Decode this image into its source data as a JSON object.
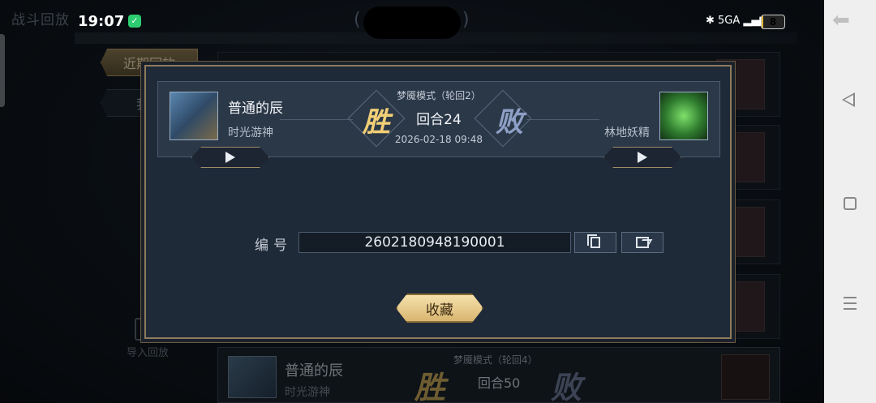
{
  "screen": {
    "page_title": "战斗回放",
    "tabs": [
      "近期回放",
      "我的"
    ],
    "import_label": "导入回放"
  },
  "status_bar": {
    "time": "19:07",
    "signal": "5GA",
    "battery": "8",
    "battery_level": 0.08
  },
  "background_row": {
    "player_name": "普通的辰",
    "player_title": "时光游神",
    "mode": "梦魇模式（轮回4）",
    "result_win": "胜",
    "round": "回合50",
    "result_lose": "败"
  },
  "modal": {
    "left_player": {
      "name": "普通的辰",
      "title": "时光游神"
    },
    "right_player": {
      "title": "林地妖精"
    },
    "mode": "梦魇模式（轮回2）",
    "win_glyph": "胜",
    "lose_glyph": "败",
    "round": "回合24",
    "datetime": "2026-02-18 09:48",
    "id_label": "编号",
    "id_value": "2602180948190001",
    "favorite_label": "收藏"
  },
  "icons": {
    "play": "play-icon",
    "copy": "copy-icon",
    "share": "share-icon",
    "back": "back-icon",
    "home": "home-icon",
    "menu": "menu-icon"
  },
  "colors": {
    "win": "#f2cf76",
    "lose": "#8fa0c6",
    "frame_gold": "#8f7c5c",
    "modal_bg": "#1f2a38"
  }
}
